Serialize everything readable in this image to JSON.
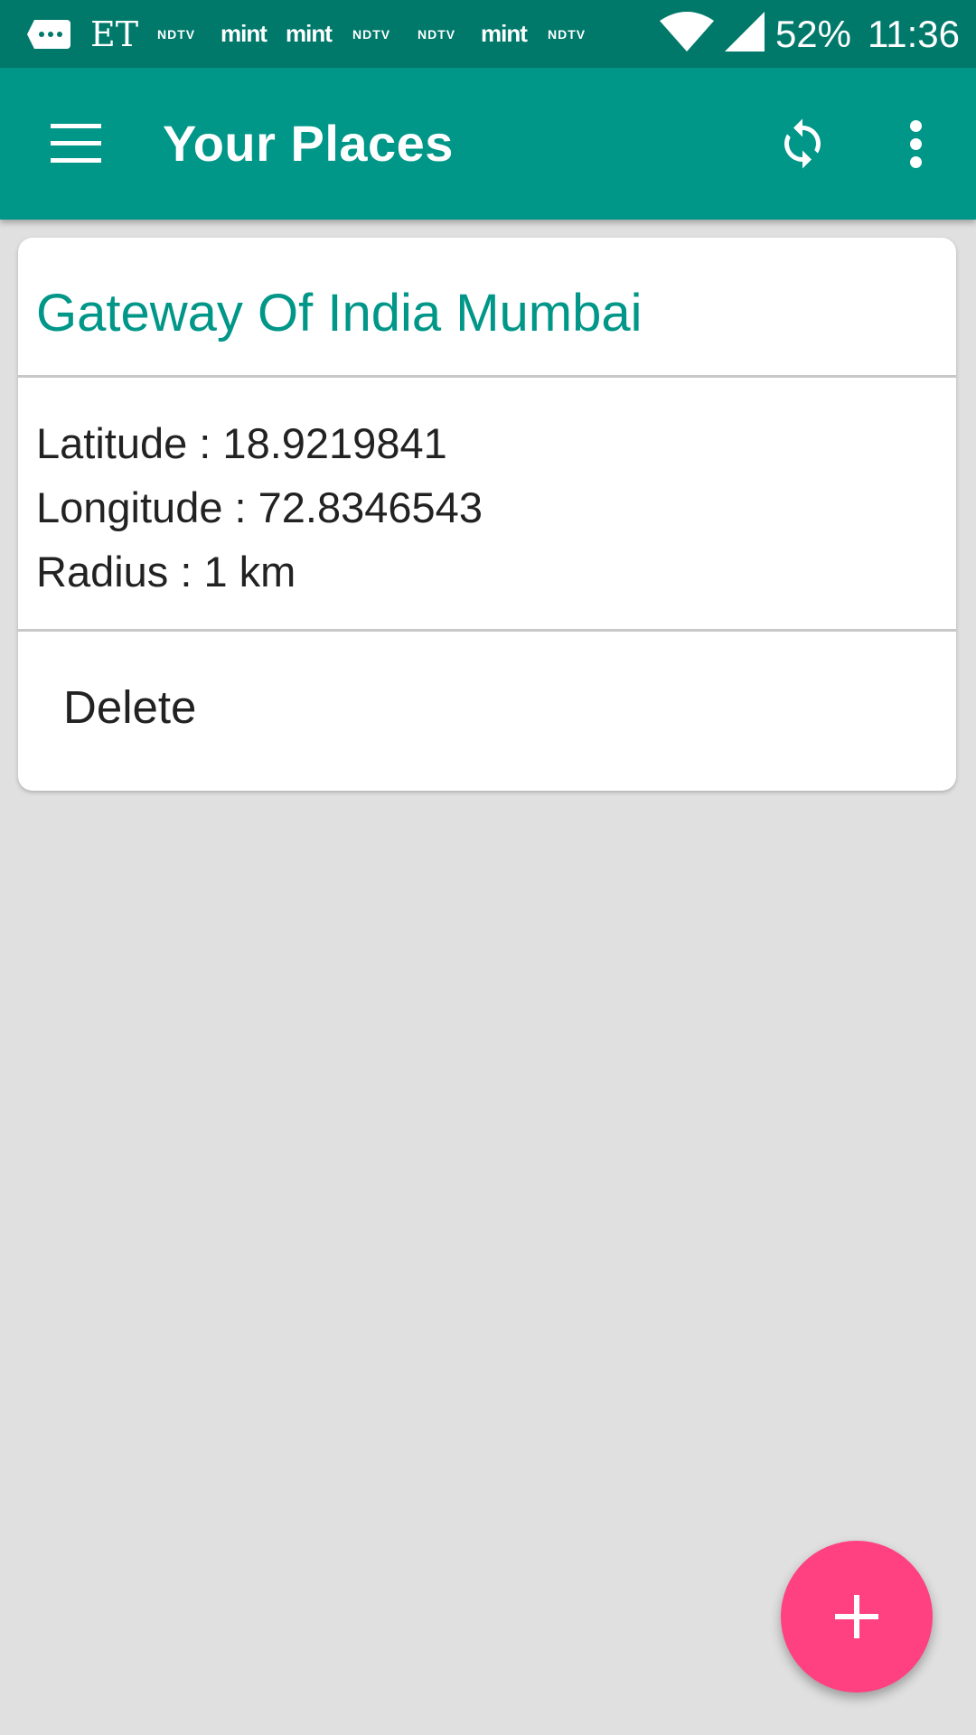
{
  "status_bar": {
    "notifications": [
      "message-icon",
      "ET",
      "NDTV",
      "mint",
      "mint",
      "NDTV",
      "NDTV",
      "mint",
      "NDTV"
    ],
    "battery": "52%",
    "time": "11:36"
  },
  "app_bar": {
    "title": "Your Places",
    "icons": [
      "menu-icon",
      "refresh-icon",
      "more-vert-icon"
    ]
  },
  "place_card": {
    "title": "Gateway Of India Mumbai",
    "latitude": "Latitude : 18.9219841",
    "longitude": "Longitude : 72.8346543",
    "radius": "Radius : 1 km",
    "delete_label": "Delete"
  },
  "fab": {
    "icon": "add-icon"
  },
  "colors": {
    "status_bar": "#00796b",
    "app_bar": "#009688",
    "accent": "#ff4081",
    "background": "#e0e0e0",
    "card_title": "#009688"
  }
}
